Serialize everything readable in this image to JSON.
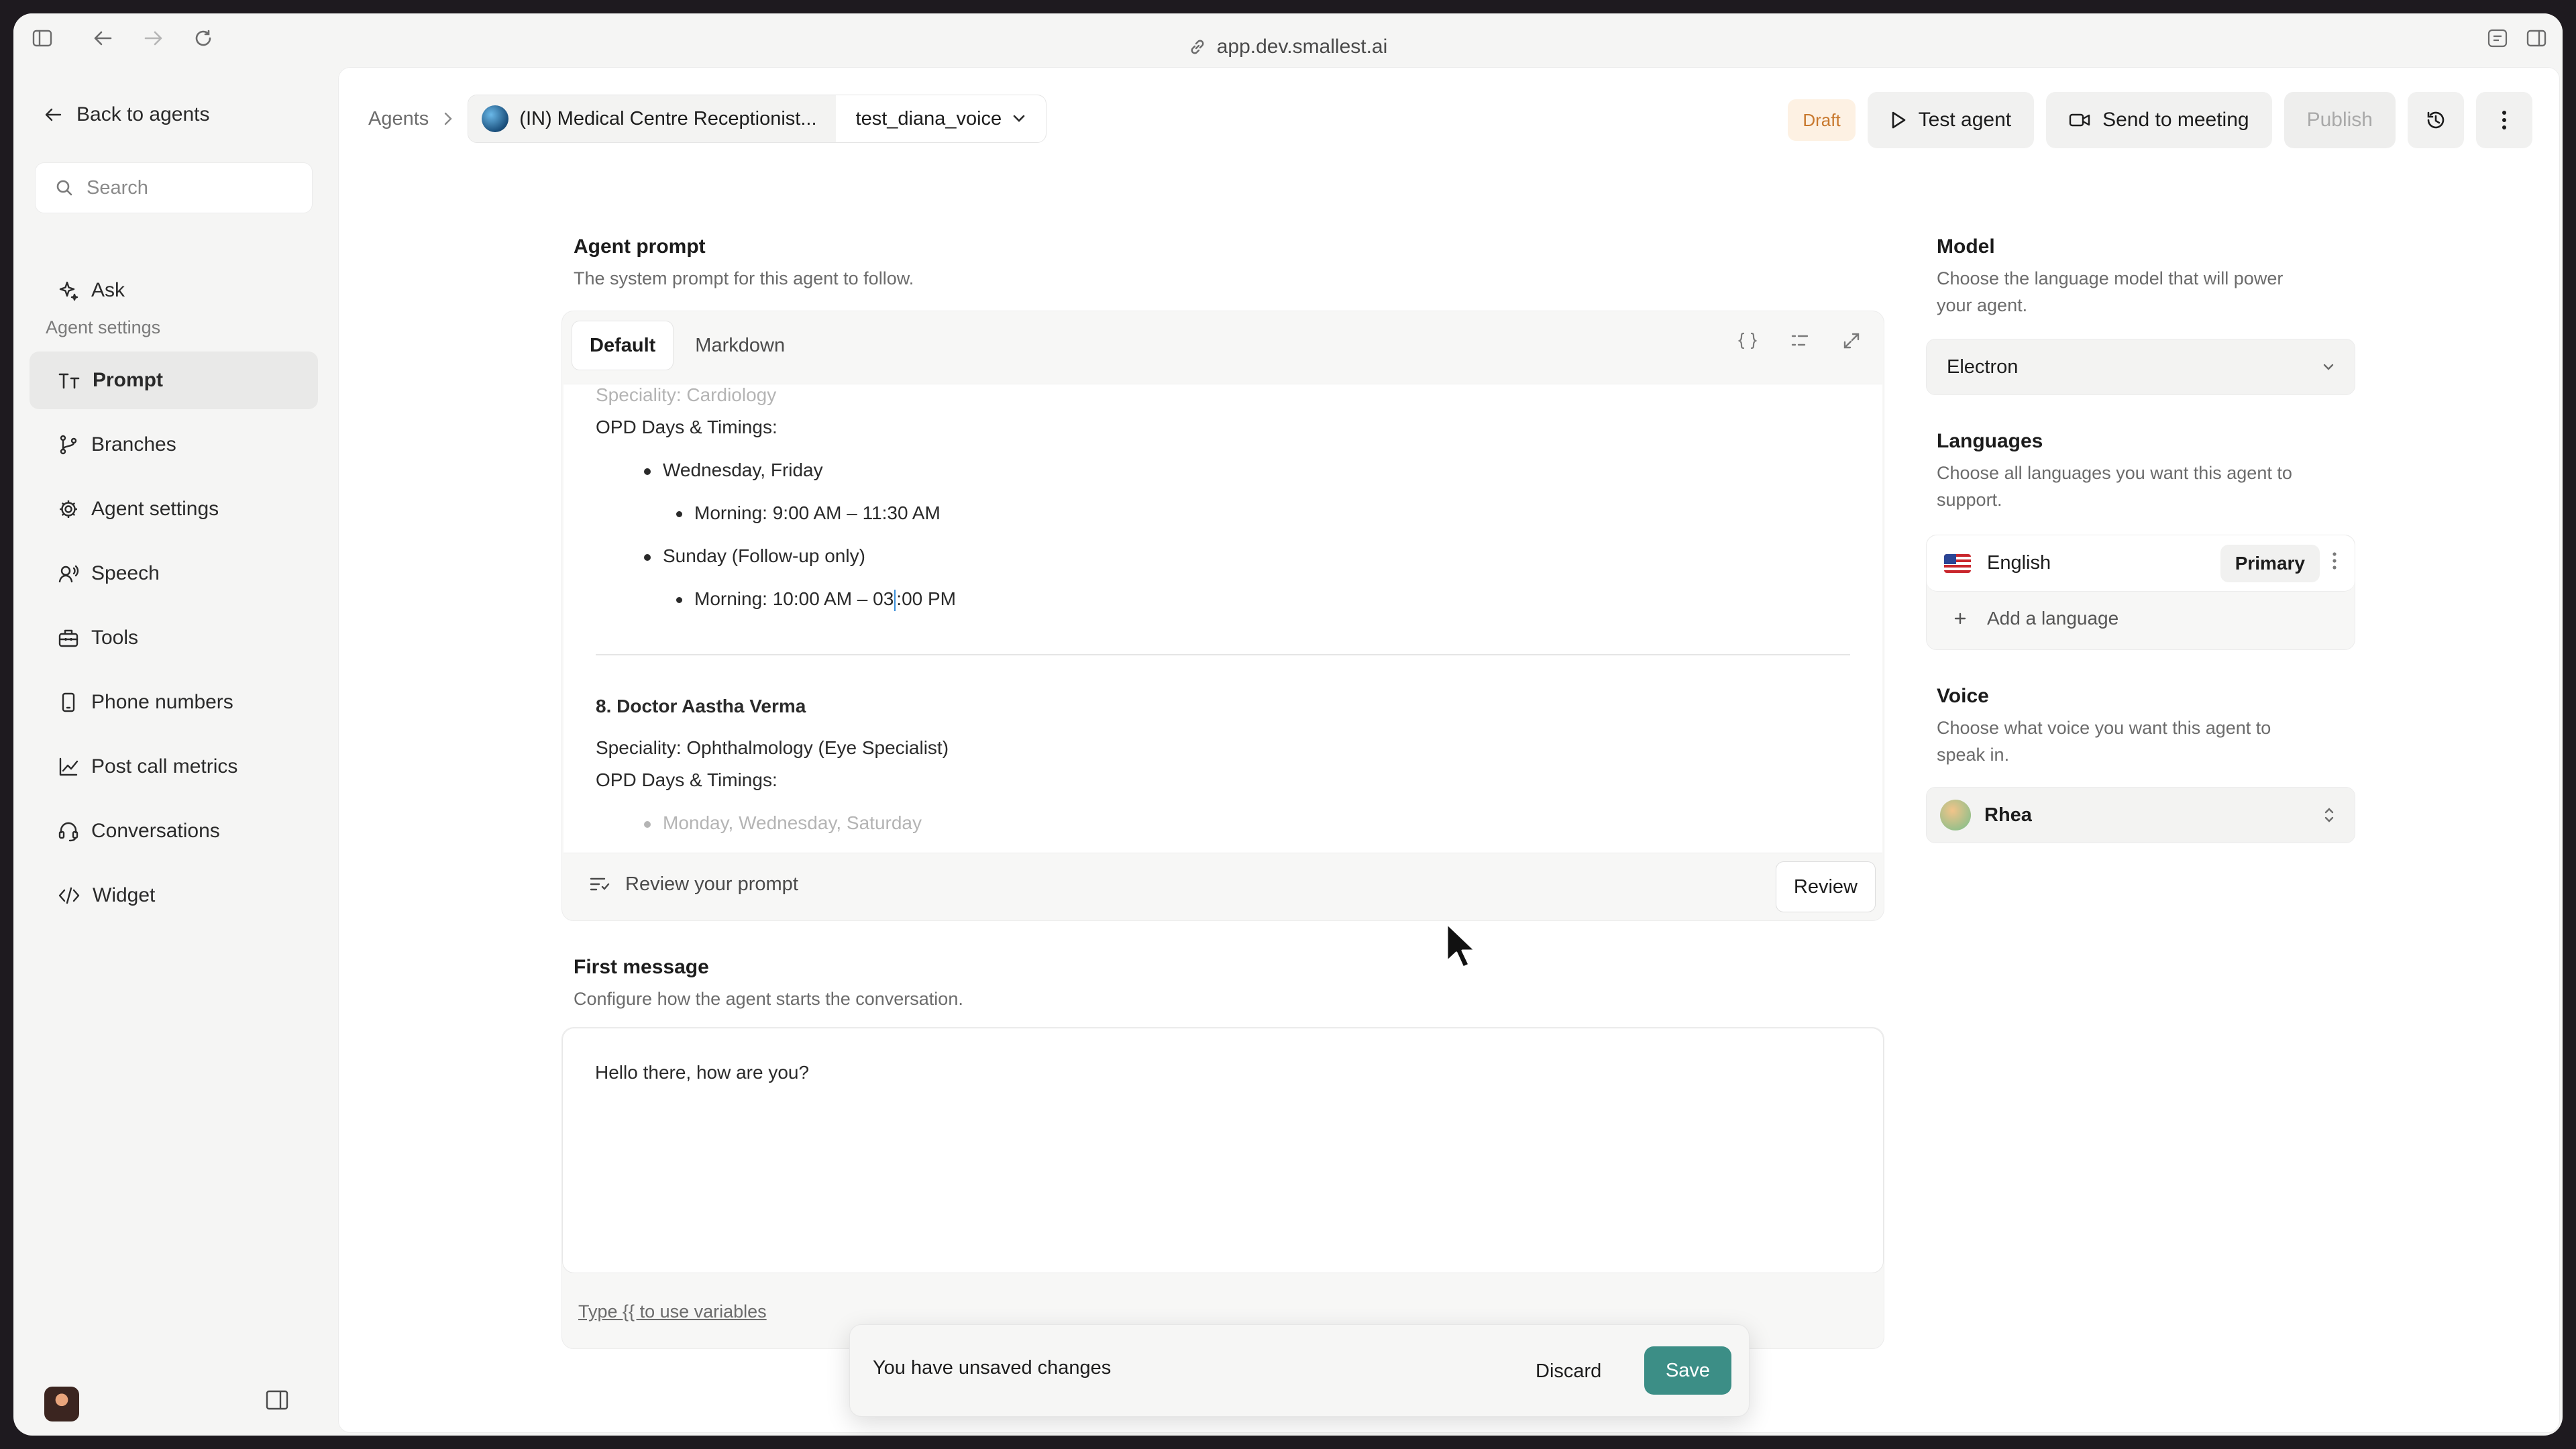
{
  "browser": {
    "url": "app.dev.smallest.ai"
  },
  "sidebar": {
    "back_label": "Back to agents",
    "search_placeholder": "Search",
    "ask_label": "Ask",
    "section_label": "Agent settings",
    "items": [
      {
        "label": "Prompt",
        "icon": "prompt-icon",
        "active": true
      },
      {
        "label": "Branches",
        "icon": "branch-icon",
        "active": false
      },
      {
        "label": "Agent settings",
        "icon": "gear-icon",
        "active": false
      },
      {
        "label": "Speech",
        "icon": "speech-icon",
        "active": false
      },
      {
        "label": "Tools",
        "icon": "toolbox-icon",
        "active": false
      },
      {
        "label": "Phone numbers",
        "icon": "phone-icon",
        "active": false
      },
      {
        "label": "Post call metrics",
        "icon": "chart-icon",
        "active": false
      },
      {
        "label": "Conversations",
        "icon": "headset-icon",
        "active": false
      },
      {
        "label": "Widget",
        "icon": "code-icon",
        "active": false
      }
    ]
  },
  "header": {
    "breadcrumb_root": "Agents",
    "agent_name": "(IN) Medical Centre Receptionist...",
    "version_name": "test_diana_voice",
    "status_badge": "Draft",
    "test_agent": "Test agent",
    "send_to_meeting": "Send to meeting",
    "publish": "Publish"
  },
  "prompt": {
    "title": "Agent prompt",
    "subtitle": "The system prompt for this agent to follow.",
    "tabs": [
      "Default",
      "Markdown"
    ],
    "lines": {
      "faded_top": "Speciality: Cardiology",
      "opd1": "OPD Days & Timings:",
      "day1": "Wednesday, Friday",
      "time1": "Morning: 9:00 AM – 11:30 AM",
      "day2": "Sunday (Follow-up only)",
      "time2_a": "Morning: 10:00 AM – 03",
      "time2_b": ":00 PM",
      "doctor": "8. Doctor Aastha Verma",
      "speciality": "Speciality: Ophthalmology (Eye Specialist)",
      "opd2": "OPD Days & Timings:",
      "faded_bottom": "Monday, Wednesday, Saturday"
    },
    "review_hint": "Review your prompt",
    "review_button": "Review"
  },
  "first_message": {
    "title": "First message",
    "subtitle": "Configure how the agent starts the conversation.",
    "value": "Hello there, how are you?",
    "hint": "Type {{ to use variables"
  },
  "model": {
    "title": "Model",
    "subtitle_1": "Choose the language model that will power",
    "subtitle_2": "your agent.",
    "value": "Electron"
  },
  "languages": {
    "title": "Languages",
    "subtitle_1": "Choose all languages you want this agent to",
    "subtitle_2": "support.",
    "items": [
      {
        "name": "English",
        "badge": "Primary"
      }
    ],
    "add_label": "Add a language"
  },
  "voice": {
    "title": "Voice",
    "subtitle_1": "Choose what voice you want this agent to",
    "subtitle_2": "speak in.",
    "value": "Rhea"
  },
  "unsaved": {
    "message": "You have unsaved changes",
    "discard": "Discard",
    "save": "Save"
  },
  "colors": {
    "accent": "#3c8e86",
    "draft_text": "#c8782d",
    "draft_bg": "#fdf1e3"
  }
}
